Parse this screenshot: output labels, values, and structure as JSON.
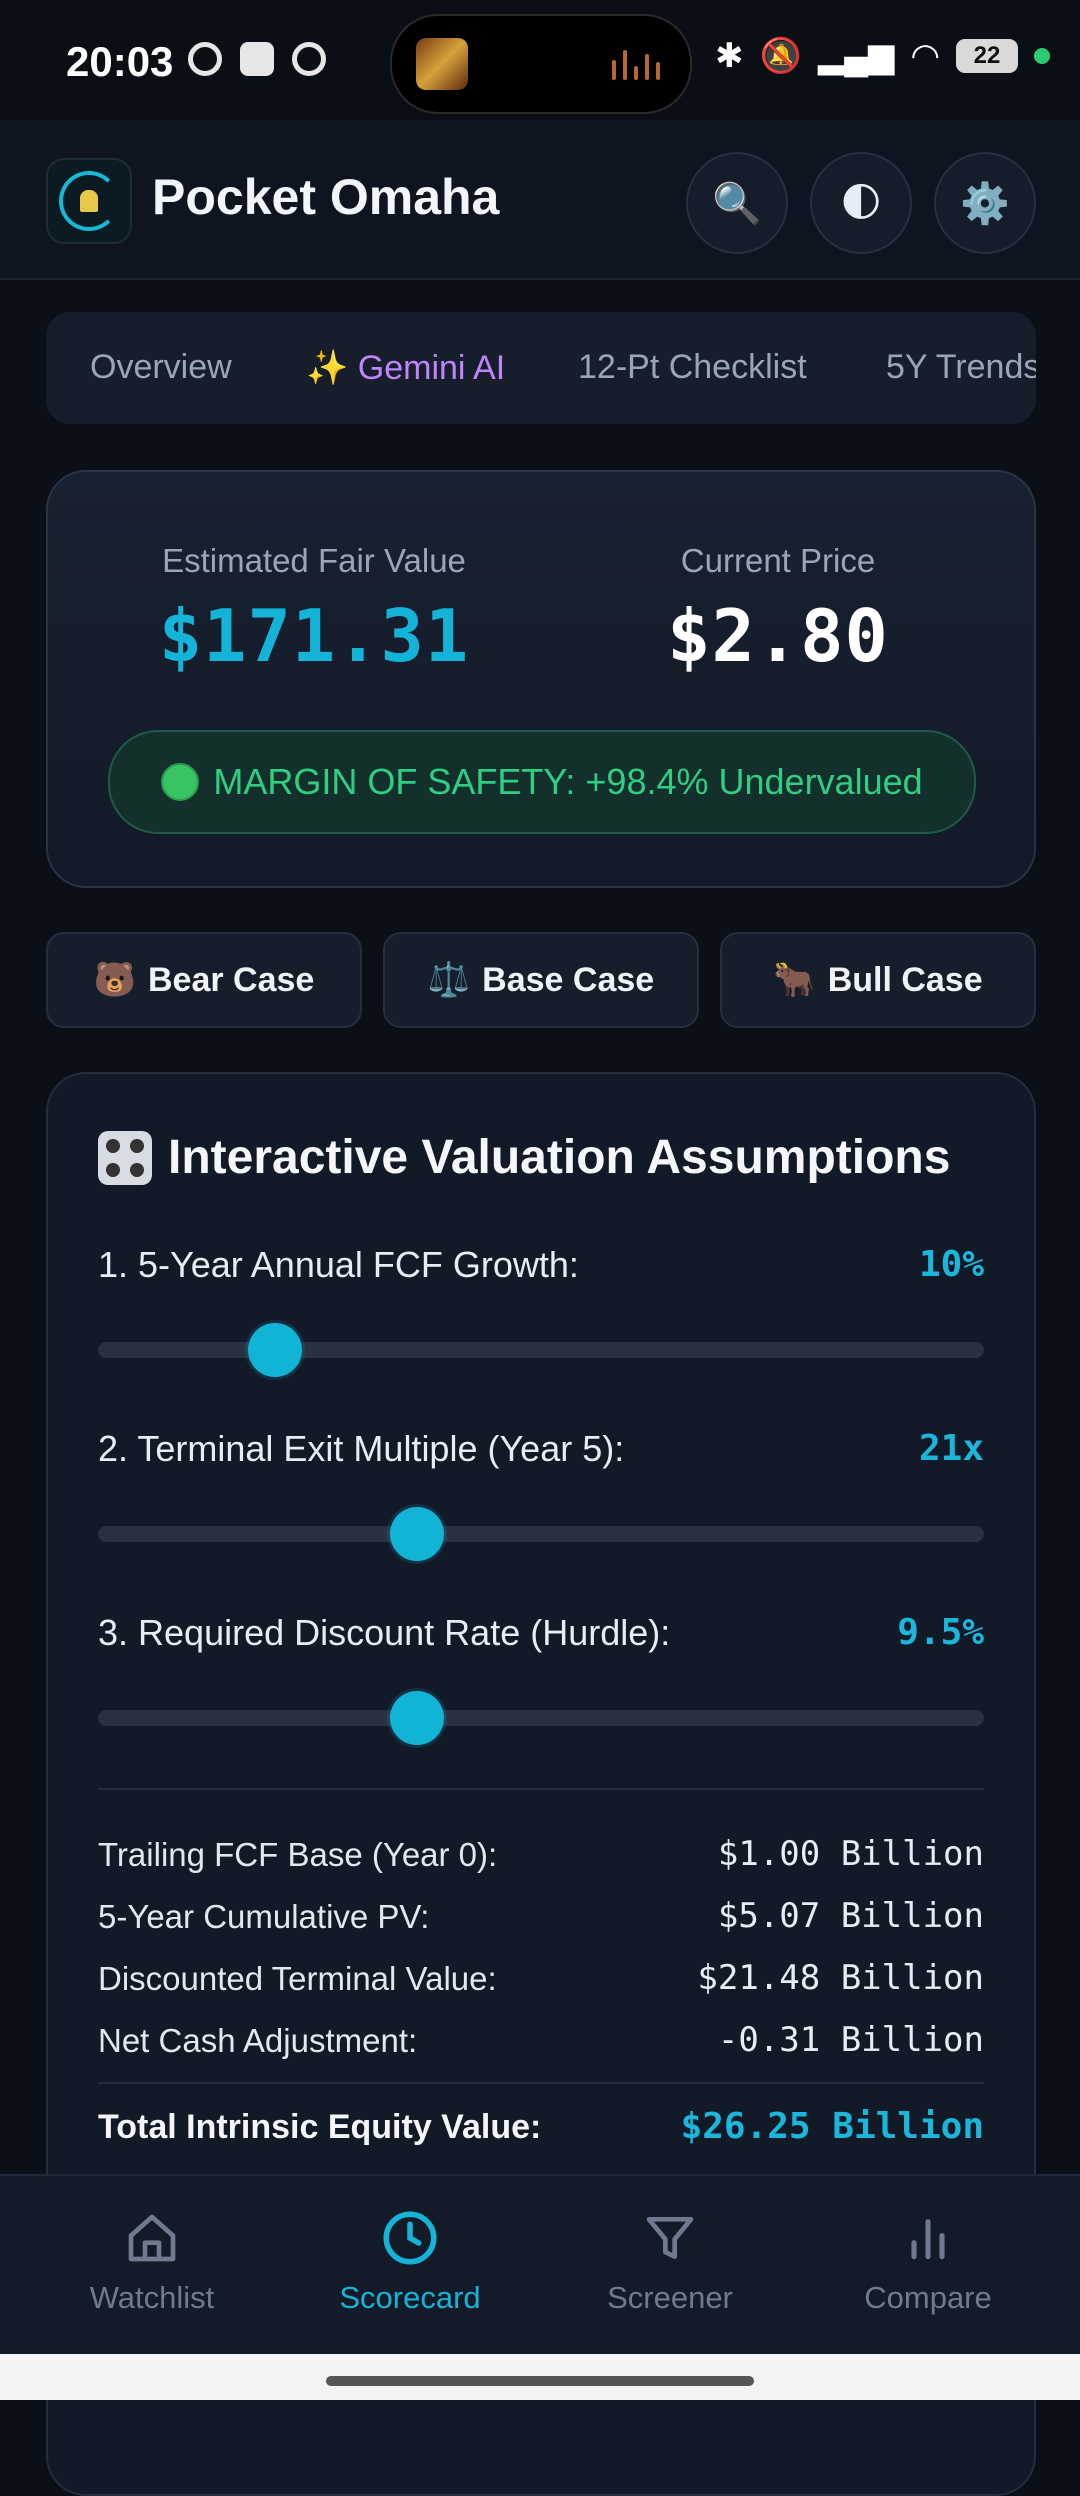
{
  "status_bar": {
    "time": "20:03",
    "battery": "22"
  },
  "header": {
    "title": "Pocket Omaha",
    "buttons": [
      "search-icon",
      "moon-icon",
      "gear-icon"
    ]
  },
  "tabs": [
    {
      "label": "Overview"
    },
    {
      "label": "✨ Gemini AI"
    },
    {
      "label": "12-Pt Checklist"
    },
    {
      "label": "5Y Trends"
    }
  ],
  "valuation": {
    "fair_value_label": "Estimated Fair Value",
    "fair_value": "$171.31",
    "price_label": "Current Price",
    "price": "$2.80",
    "margin_text": "MARGIN OF SAFETY: +98.4% Undervalued"
  },
  "scenarios": [
    {
      "icon": "🐻",
      "label": "Bear Case"
    },
    {
      "icon": "⚖️",
      "label": "Base Case"
    },
    {
      "icon": "🐂",
      "label": "Bull Case"
    }
  ],
  "assumptions": {
    "title": "Interactive Valuation Assumptions",
    "params": [
      {
        "label": "1. 5-Year Annual FCF Growth:",
        "value": "10%",
        "level": 0.2
      },
      {
        "label": "2. Terminal Exit Multiple (Year 5):",
        "value": "21x",
        "level": 0.36
      },
      {
        "label": "3. Required Discount Rate (Hurdle):",
        "value": "9.5%",
        "level": 0.36
      }
    ],
    "rows": [
      {
        "label": "Trailing FCF Base (Year 0):",
        "value": "$1.00 Billion"
      },
      {
        "label": "5-Year Cumulative PV:",
        "value": "$5.07 Billion"
      },
      {
        "label": "Discounted Terminal Value:",
        "value": "$21.48 Billion"
      },
      {
        "label": "Net Cash Adjustment:",
        "value": "-0.31 Billion"
      }
    ],
    "total_label": "Total Intrinsic Equity Value:",
    "total_value": "$26.25 Billion"
  },
  "bottom_nav": [
    {
      "label": "Watchlist",
      "icon": "home-icon"
    },
    {
      "label": "Scorecard",
      "icon": "clock-icon"
    },
    {
      "label": "Screener",
      "icon": "filter-icon"
    },
    {
      "label": "Compare",
      "icon": "bar-chart-icon"
    }
  ],
  "colors": {
    "accent": "#14b4d8",
    "gemini": "#c084fc",
    "success": "#2fcf82",
    "background": "#0b0f17"
  }
}
